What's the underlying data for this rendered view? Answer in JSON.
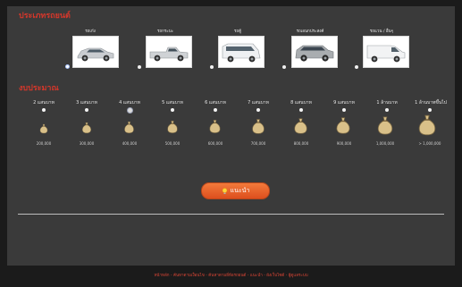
{
  "vehicle_section": {
    "title": "ประเภทรถยนต์",
    "types": [
      {
        "label": "รถเก๋ง",
        "icon": "sedan-car",
        "checked": true
      },
      {
        "label": "รถกระบะ",
        "icon": "pickup-truck",
        "checked": false
      },
      {
        "label": "รถตู้",
        "icon": "passenger-van",
        "checked": false
      },
      {
        "label": "รถเอนกประสงค์",
        "icon": "mpv-suv",
        "checked": false
      },
      {
        "label": "รถแวน / อื่นๆ",
        "icon": "cargo-van",
        "checked": false
      }
    ]
  },
  "budget_section": {
    "title": "งบประมาณ",
    "options": [
      {
        "label": "2 แสนบาท",
        "amount": "200,000",
        "level": 1,
        "checked": false
      },
      {
        "label": "3 แสนบาท",
        "amount": "300,000",
        "level": 2,
        "checked": false
      },
      {
        "label": "4 แสนบาท",
        "amount": "400,000",
        "level": 3,
        "checked": true
      },
      {
        "label": "5 แสนบาท",
        "amount": "500,000",
        "level": 4,
        "checked": false
      },
      {
        "label": "6 แสนบาท",
        "amount": "600,000",
        "level": 5,
        "checked": false
      },
      {
        "label": "7 แสนบาท",
        "amount": "700,000",
        "level": 6,
        "checked": false
      },
      {
        "label": "8 แสนบาท",
        "amount": "800,000",
        "level": 7,
        "checked": false
      },
      {
        "label": "9 แสนบาท",
        "amount": "900,000",
        "level": 8,
        "checked": false
      },
      {
        "label": "1 ล้านบาท",
        "amount": "1,000,000",
        "level": 9,
        "checked": false
      },
      {
        "label": "1 ล้านบาทขึ้นไป",
        "amount": "> 1,000,000",
        "level": 10,
        "checked": false
      }
    ]
  },
  "recommend_button": {
    "label": "แนะนำ",
    "icon": "lightbulb"
  },
  "footer": {
    "text": "หน้าหลัก - ค้นหาตามเงื่อนไข - ค้นหาตามยี่ห้อรถยนต์ - แนะนำ - ผังเว็บไซต์ - ผู้ดูแลระบบ"
  },
  "colors": {
    "accent_red": "#d4372b",
    "panel": "#3a3a3a",
    "background": "#1b1b1b",
    "button_orange": "#ee6a2f",
    "bag": "#d9c089"
  }
}
